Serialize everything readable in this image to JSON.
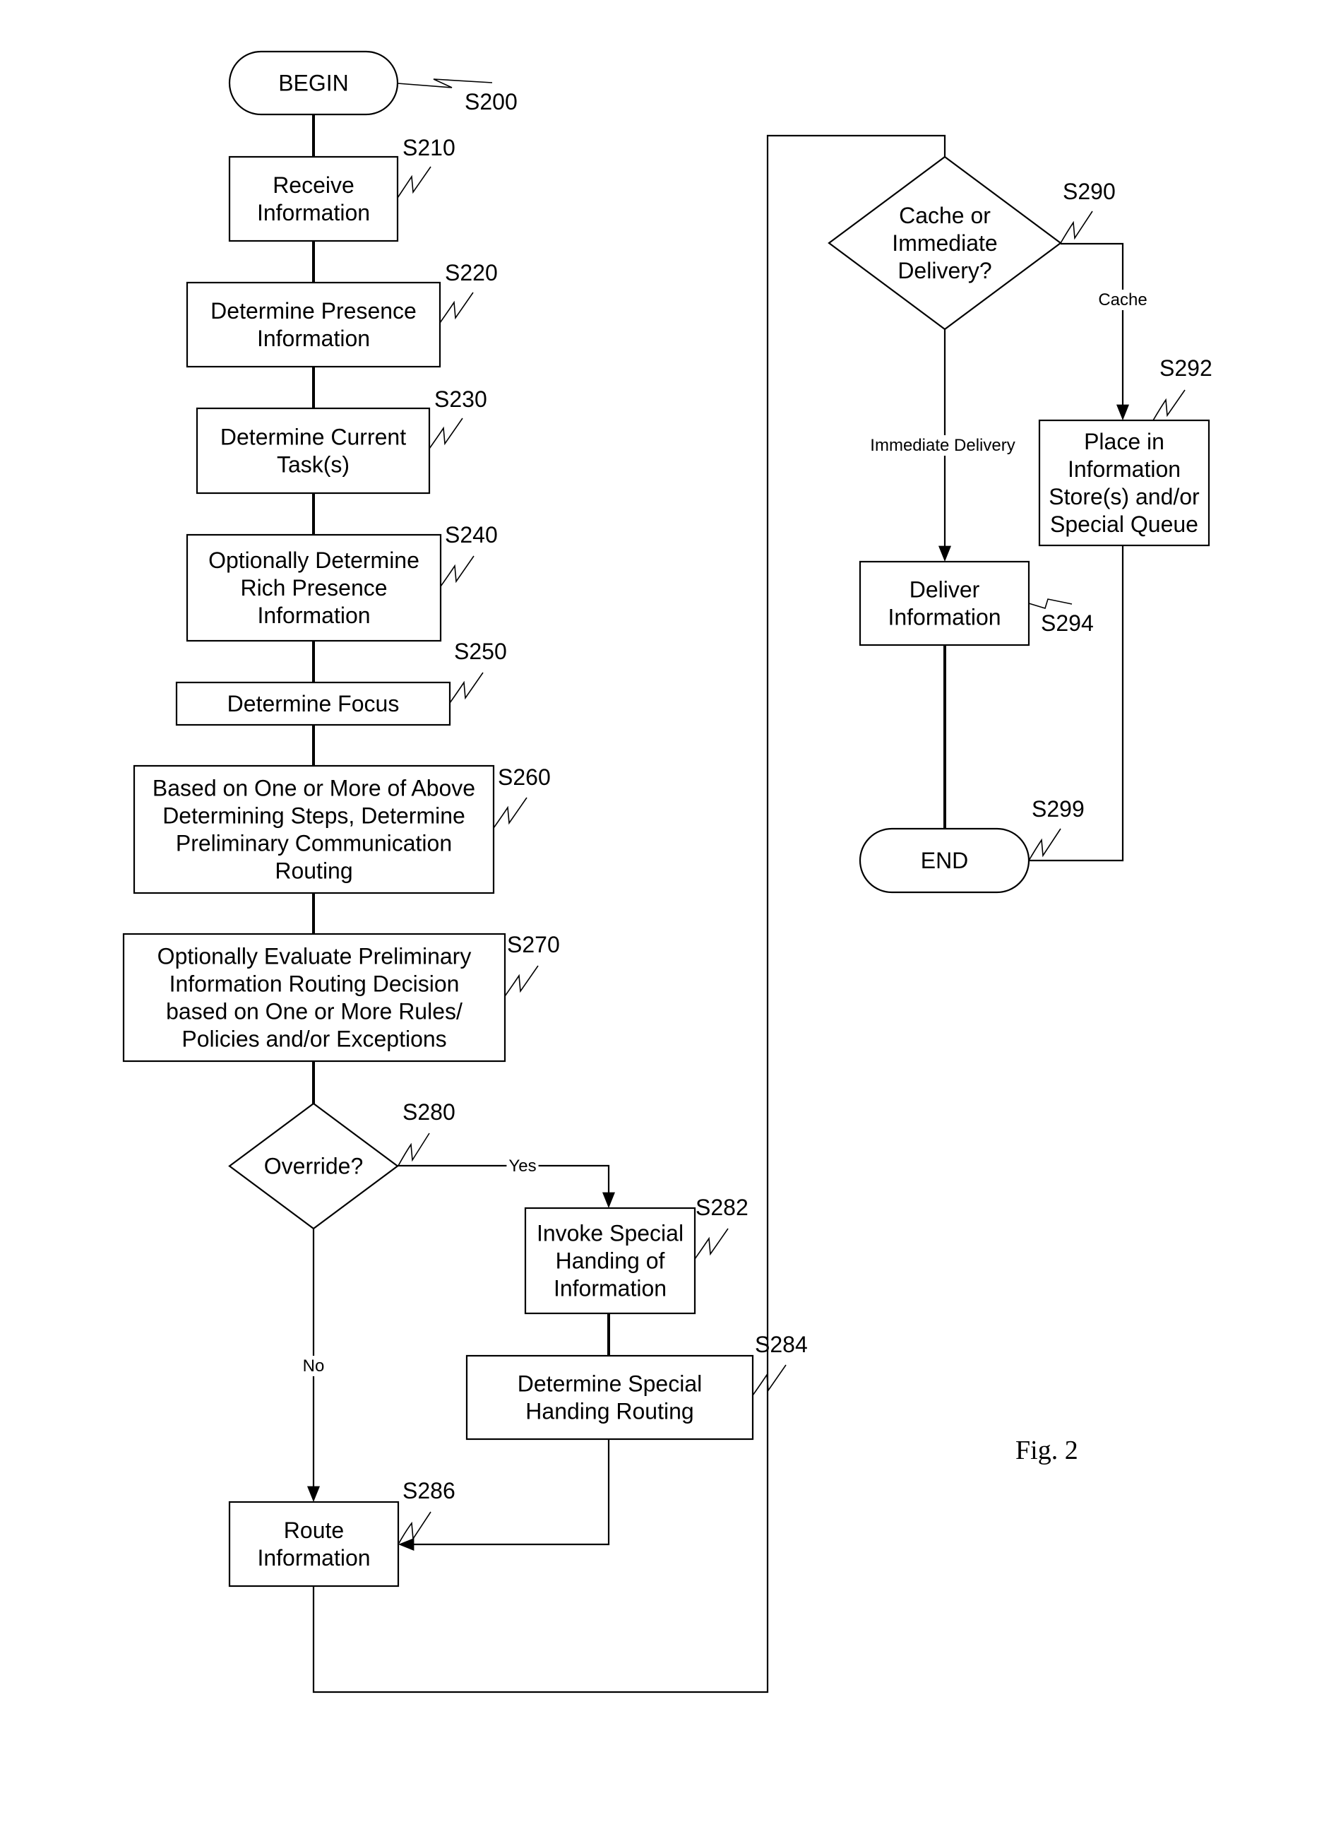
{
  "figure": {
    "caption": "Fig. 2",
    "kind": "flowchart"
  },
  "nodes": {
    "S200": {
      "ref": "S200",
      "shape": "terminal",
      "lines": [
        "BEGIN"
      ]
    },
    "S210": {
      "ref": "S210",
      "shape": "process",
      "lines": [
        "Receive",
        "Information"
      ]
    },
    "S220": {
      "ref": "S220",
      "shape": "process",
      "lines": [
        "Determine Presence",
        "Information"
      ]
    },
    "S230": {
      "ref": "S230",
      "shape": "process",
      "lines": [
        "Determine Current",
        "Task(s)"
      ]
    },
    "S240": {
      "ref": "S240",
      "shape": "process",
      "lines": [
        "Optionally Determine",
        "Rich Presence",
        "Information"
      ]
    },
    "S250": {
      "ref": "S250",
      "shape": "process",
      "lines": [
        "Determine Focus"
      ]
    },
    "S260": {
      "ref": "S260",
      "shape": "process",
      "lines": [
        "Based on One or More of Above",
        "Determining Steps, Determine",
        "Preliminary Communication",
        "Routing"
      ]
    },
    "S270": {
      "ref": "S270",
      "shape": "process",
      "lines": [
        "Optionally Evaluate Preliminary",
        "Information Routing Decision",
        "based on One or More Rules/",
        "Policies and/or Exceptions"
      ]
    },
    "S280": {
      "ref": "S280",
      "shape": "decision",
      "lines": [
        "Override?"
      ]
    },
    "S282": {
      "ref": "S282",
      "shape": "process",
      "lines": [
        "Invoke Special",
        "Handing of",
        "Information"
      ]
    },
    "S284": {
      "ref": "S284",
      "shape": "process",
      "lines": [
        "Determine Special",
        "Handing Routing"
      ]
    },
    "S286": {
      "ref": "S286",
      "shape": "process",
      "lines": [
        "Route",
        "Information"
      ]
    },
    "S290": {
      "ref": "S290",
      "shape": "decision",
      "lines": [
        "Cache or",
        "Immediate",
        "Delivery?"
      ]
    },
    "S292": {
      "ref": "S292",
      "shape": "process",
      "lines": [
        "Place in",
        "Information",
        "Store(s) and/or",
        "Special Queue"
      ]
    },
    "S294": {
      "ref": "S294",
      "shape": "process",
      "lines": [
        "Deliver",
        "Information"
      ]
    },
    "S299": {
      "ref": "S299",
      "shape": "terminal",
      "lines": [
        "END"
      ]
    }
  },
  "edges": [
    {
      "from": "S200",
      "to": "S210",
      "label": ""
    },
    {
      "from": "S210",
      "to": "S220",
      "label": ""
    },
    {
      "from": "S220",
      "to": "S230",
      "label": ""
    },
    {
      "from": "S230",
      "to": "S240",
      "label": ""
    },
    {
      "from": "S240",
      "to": "S250",
      "label": ""
    },
    {
      "from": "S250",
      "to": "S260",
      "label": ""
    },
    {
      "from": "S260",
      "to": "S270",
      "label": ""
    },
    {
      "from": "S270",
      "to": "S280",
      "label": ""
    },
    {
      "from": "S280",
      "to": "S282",
      "label": "Yes"
    },
    {
      "from": "S280",
      "to": "S286",
      "label": "No"
    },
    {
      "from": "S282",
      "to": "S284",
      "label": ""
    },
    {
      "from": "S284",
      "to": "S286",
      "label": ""
    },
    {
      "from": "S286",
      "to": "S290",
      "label": ""
    },
    {
      "from": "S290",
      "to": "S292",
      "label": "Cache"
    },
    {
      "from": "S290",
      "to": "S294",
      "label": "Immediate Delivery"
    },
    {
      "from": "S292",
      "to": "S299",
      "label": ""
    },
    {
      "from": "S294",
      "to": "S299",
      "label": ""
    }
  ]
}
